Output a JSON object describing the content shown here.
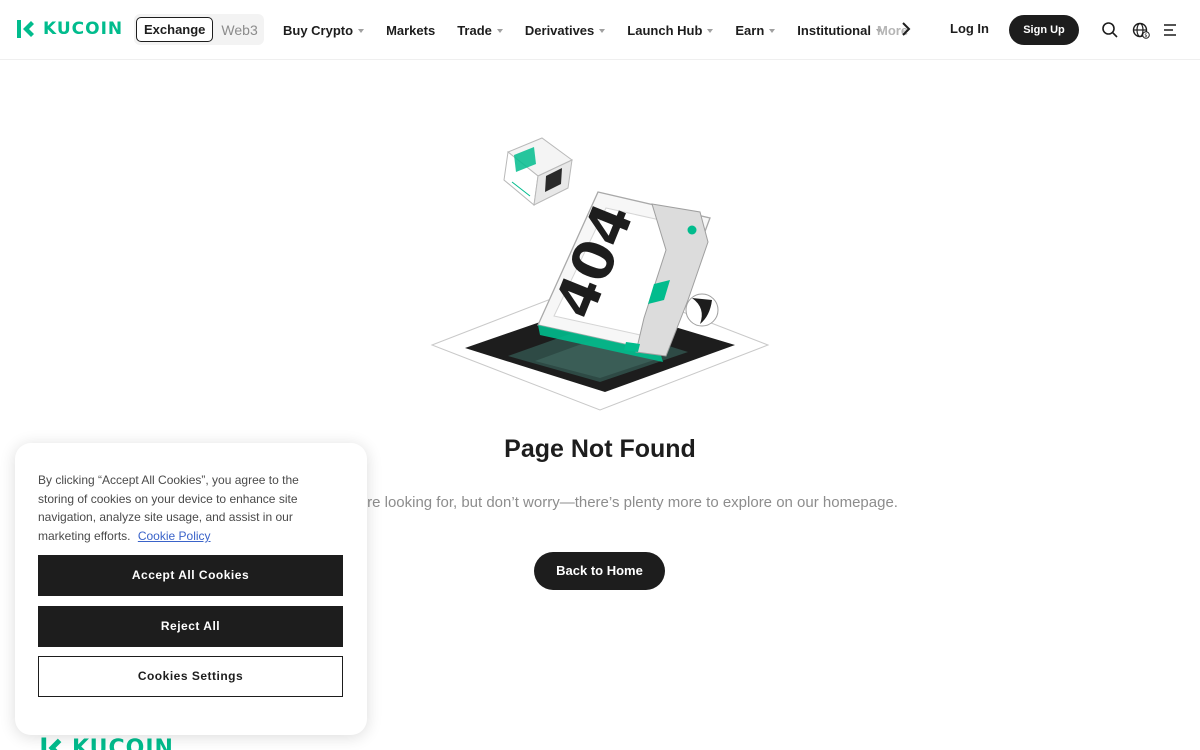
{
  "header": {
    "brand": "KUCOIN",
    "switch": {
      "active": "Exchange",
      "inactive": "Web3"
    },
    "nav": [
      {
        "label": "Buy Crypto",
        "dropdown": true
      },
      {
        "label": "Markets",
        "dropdown": false
      },
      {
        "label": "Trade",
        "dropdown": true
      },
      {
        "label": "Derivatives",
        "dropdown": true
      },
      {
        "label": "Launch Hub",
        "dropdown": true
      },
      {
        "label": "Earn",
        "dropdown": true
      },
      {
        "label": "Institutional",
        "dropdown": true
      }
    ],
    "nav_more": "More",
    "login": "Log In",
    "signup": "Sign Up",
    "icons": [
      "search-icon",
      "globe-currency-icon",
      "menu-icon",
      "chevron-right-icon"
    ]
  },
  "main": {
    "illustration_text": "404",
    "title": "Page Not Found",
    "subtitle": "page you’re looking for, but don’t worry—there’s plenty more to explore on our homepage.",
    "home_button": "Back to Home"
  },
  "cookie": {
    "text": "By clicking “Accept All Cookies”, you agree to the storing of cookies on your device to enhance site navigation, analyze site usage, and assist in our marketing efforts.",
    "policy_link": "Cookie Policy",
    "accept": "Accept All Cookies",
    "reject": "Reject All",
    "settings": "Cookies Settings"
  },
  "footer": {
    "brand": "KUCOIN"
  },
  "colors": {
    "brand": "#01bc8d",
    "dark": "#1d1d1d",
    "muted": "#8d8d8d",
    "link": "#3a63c9"
  }
}
